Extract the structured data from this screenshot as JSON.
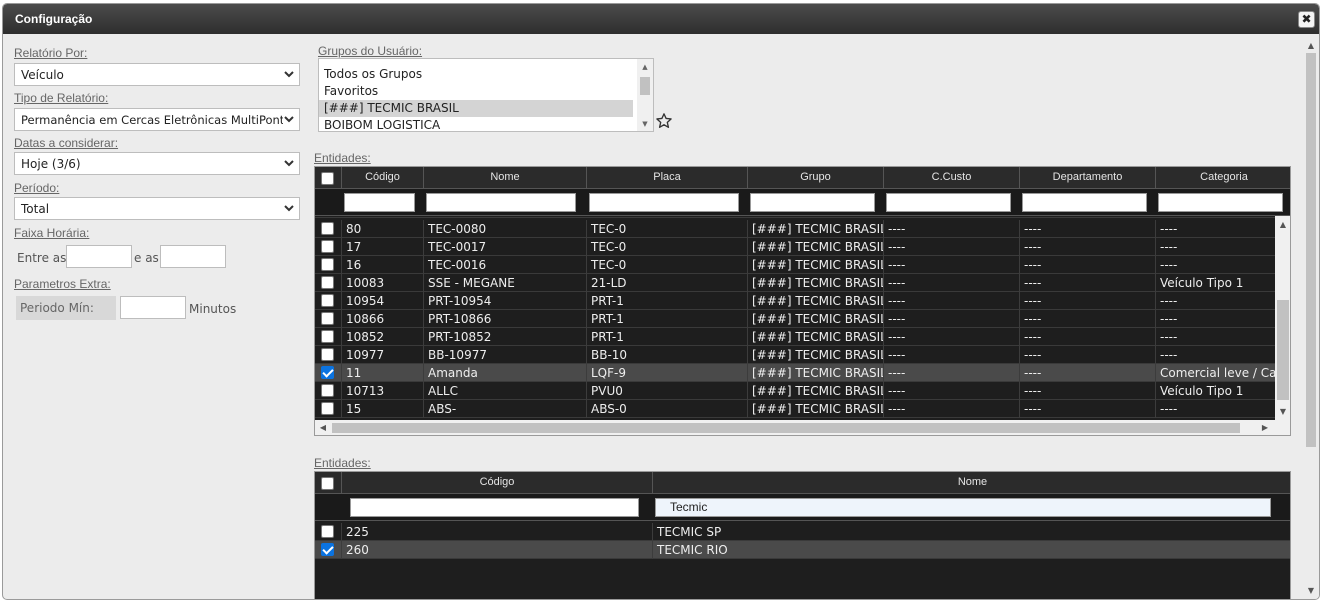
{
  "dialog": {
    "title": "Configuração"
  },
  "left": {
    "relatorio_por": {
      "label": "Relatório Por:",
      "value": "Veículo"
    },
    "tipo_relatorio": {
      "label": "Tipo de Relatório:",
      "value": "Permanência em Cercas Eletrônicas MultiPonto"
    },
    "datas": {
      "label": "Datas a considerar:",
      "value": "Hoje (3/6)"
    },
    "periodo": {
      "label": "Período:",
      "value": "Total"
    },
    "faixa": {
      "label": "Faixa Horária:",
      "entre": "Entre as",
      "e_as": "e as"
    },
    "extra": {
      "label": "Parametros Extra:",
      "periodo_min": "Periodo Mín:",
      "minutos": "Minutos"
    }
  },
  "groups": {
    "label": "Grupos do Usuário:",
    "items": [
      "Todos os Grupos",
      "Favoritos",
      "[###] TECMIC BRASIL",
      "BOIBOM LOGISTICA"
    ],
    "selected_index": 2
  },
  "entities1": {
    "label": "Entidades:",
    "headers": [
      "Código",
      "Nome",
      "Placa",
      "Grupo",
      "C.Custo",
      "Departamento",
      "Categoria"
    ],
    "rows": [
      {
        "checked": false,
        "codigo": "80",
        "nome": "TEC-0080",
        "placa": "TEC-0",
        "grupo": "[###] TECMIC BRASIL",
        "ccusto": "----",
        "depto": "----",
        "categoria": "----"
      },
      {
        "checked": false,
        "codigo": "17",
        "nome": "TEC-0017",
        "placa": "TEC-0",
        "grupo": "[###] TECMIC BRASIL",
        "ccusto": "----",
        "depto": "----",
        "categoria": "----"
      },
      {
        "checked": false,
        "codigo": "16",
        "nome": "TEC-0016",
        "placa": "TEC-0",
        "grupo": "[###] TECMIC BRASIL",
        "ccusto": "----",
        "depto": "----",
        "categoria": "----"
      },
      {
        "checked": false,
        "codigo": "10083",
        "nome": "SSE - MEGANE",
        "placa": "21-LD",
        "grupo": "[###] TECMIC BRASIL",
        "ccusto": "----",
        "depto": "----",
        "categoria": "Veículo Tipo 1"
      },
      {
        "checked": false,
        "codigo": "10954",
        "nome": "PRT-10954",
        "placa": "PRT-1",
        "grupo": "[###] TECMIC BRASIL",
        "ccusto": "----",
        "depto": "----",
        "categoria": "----"
      },
      {
        "checked": false,
        "codigo": "10866",
        "nome": "PRT-10866",
        "placa": "PRT-1",
        "grupo": "[###] TECMIC BRASIL",
        "ccusto": "----",
        "depto": "----",
        "categoria": "----"
      },
      {
        "checked": false,
        "codigo": "10852",
        "nome": "PRT-10852",
        "placa": "PRT-1",
        "grupo": "[###] TECMIC BRASIL",
        "ccusto": "----",
        "depto": "----",
        "categoria": "----"
      },
      {
        "checked": false,
        "codigo": "10977",
        "nome": "BB-10977",
        "placa": "BB-10",
        "grupo": "[###] TECMIC BRASIL",
        "ccusto": "----",
        "depto": "----",
        "categoria": "----"
      },
      {
        "checked": true,
        "codigo": "11",
        "nome": "Amanda",
        "placa": "LQF-9",
        "grupo": "[###] TECMIC BRASIL",
        "ccusto": "----",
        "depto": "----",
        "categoria": "Comercial leve / Car"
      },
      {
        "checked": false,
        "codigo": "10713",
        "nome": "ALLC",
        "placa": "PVU0",
        "grupo": "[###] TECMIC BRASIL",
        "ccusto": "----",
        "depto": "----",
        "categoria": "Veículo Tipo 1"
      },
      {
        "checked": false,
        "codigo": "15",
        "nome": "ABS-",
        "placa": "ABS-0",
        "grupo": "[###] TECMIC BRASIL",
        "ccusto": "----",
        "depto": "----",
        "categoria": "----"
      }
    ]
  },
  "entities2": {
    "label": "Entidades:",
    "headers": [
      "Código",
      "Nome"
    ],
    "filter_nome": "Tecmic",
    "rows": [
      {
        "checked": false,
        "codigo": "225",
        "nome": "TECMIC SP"
      },
      {
        "checked": true,
        "codigo": "260",
        "nome": "TECMIC RIO"
      }
    ]
  }
}
